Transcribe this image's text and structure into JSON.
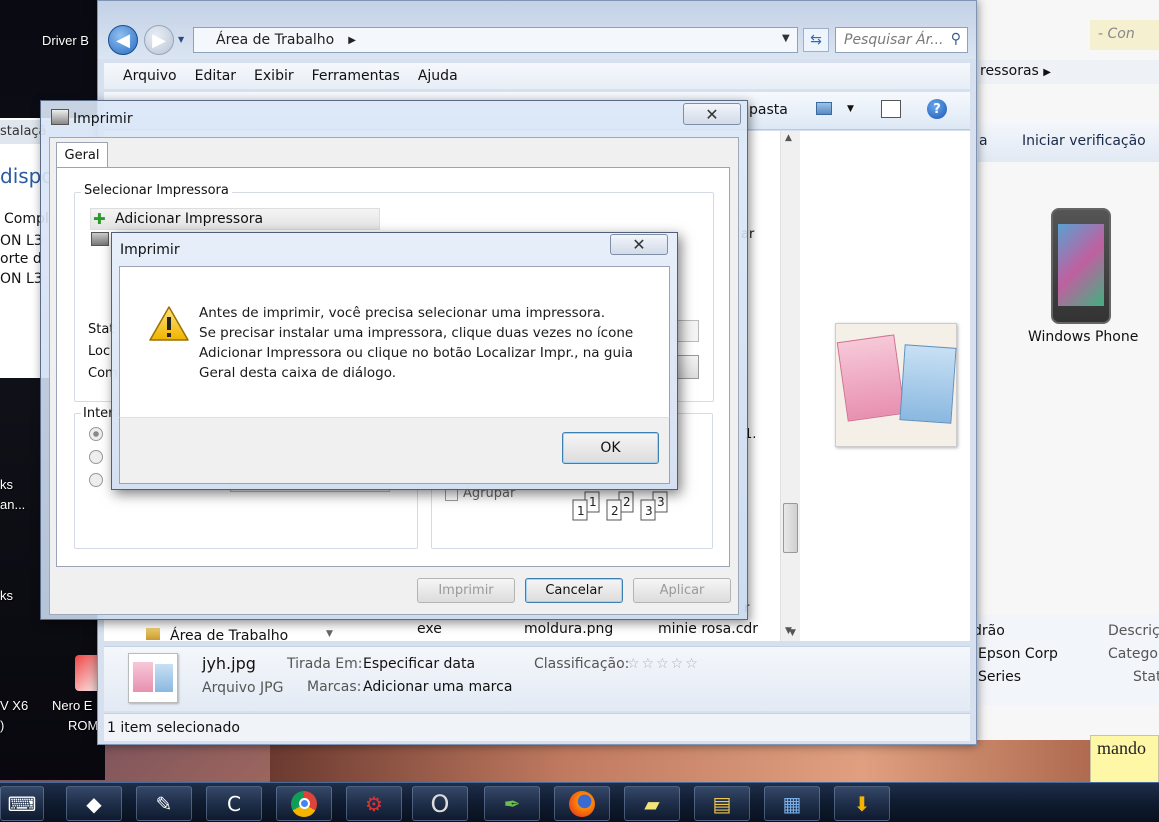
{
  "desktop": {
    "left_labels": [
      "Driver B",
      "Compl",
      "ON L3",
      "orte d",
      "ON L3",
      "ks",
      "an...",
      "ks",
      "V X6",
      ")",
      "Nero E",
      "ROM"
    ],
    "left_dispo": "dispo",
    "left_instal": "stalaçã",
    "right_menu_crumb": "ressoras",
    "right_menu_crumb_arrow": "▶",
    "right_search_hint": "- Con",
    "right_verify": "Iniciar verificação",
    "right_a": "a",
    "windows_phone": "Windows Phone",
    "right_details": {
      "row1_left": "drão",
      "row1_right": "Descriç",
      "row2_left": "Epson Corp",
      "row2_right": "Categor",
      "row3_left": "Series",
      "row3_right": "Stat"
    },
    "sticky_note": "mando"
  },
  "explorer": {
    "address": "Área de Trabalho",
    "address_arrow": "▶",
    "search_placeholder": "Pesquisar Ár...",
    "menu": [
      "Arquivo",
      "Editar",
      "Exibir",
      "Ferramentas",
      "Ajuda"
    ],
    "toolbar_pasta": "pasta",
    "nav_tree_item": "Área de Trabalho",
    "files_row": [
      "exe",
      "moldura.png",
      "minie rosa.cdr"
    ],
    "file_partial_ar": "ar",
    "file_partial_num": "1.",
    "file_partial_r": "r",
    "details": {
      "filename": "jyh.jpg",
      "filetype": "Arquivo JPG",
      "taken_label": "Tirada Em:",
      "taken_value": "Especificar data",
      "tags_label": "Marcas:",
      "tags_value": "Adicionar uma marca",
      "rating_label": "Classificação:",
      "rating_stars": "☆☆☆☆☆"
    },
    "status": "1 item selecionado"
  },
  "print_dialog": {
    "title": "Imprimir",
    "tab": "Geral",
    "select_printer_label": "Selecionar Impressora",
    "add_printer": "Adicionar Impressora",
    "stat_label": "Stat",
    "loc_label": "Loc",
    "com_label": "Com",
    "inter_label": "Inter",
    "collate_label": "Agrupar",
    "buttons": {
      "print": "Imprimir",
      "cancel": "Cancelar",
      "apply": "Aplicar"
    }
  },
  "alert": {
    "title": "Imprimir",
    "lines": [
      "Antes de imprimir, você precisa selecionar uma impressora.",
      "Se precisar instalar uma impressora, clique duas vezes no ícone",
      "Adicionar Impressora ou clique no botão Localizar Impr., na guia",
      "Geral desta caixa de diálogo."
    ],
    "ok": "OK"
  },
  "taskbar": {
    "items": [
      "keyboard-icon",
      "media-center-icon",
      "quill-icon",
      "ccleaner-icon",
      "chrome-icon",
      "antivirus-icon",
      "opera-icon",
      "coreldraw-icon",
      "firefox-icon",
      "sticky-notes-icon",
      "file-explorer-icon",
      "control-panel-icon",
      "download-icon"
    ]
  }
}
